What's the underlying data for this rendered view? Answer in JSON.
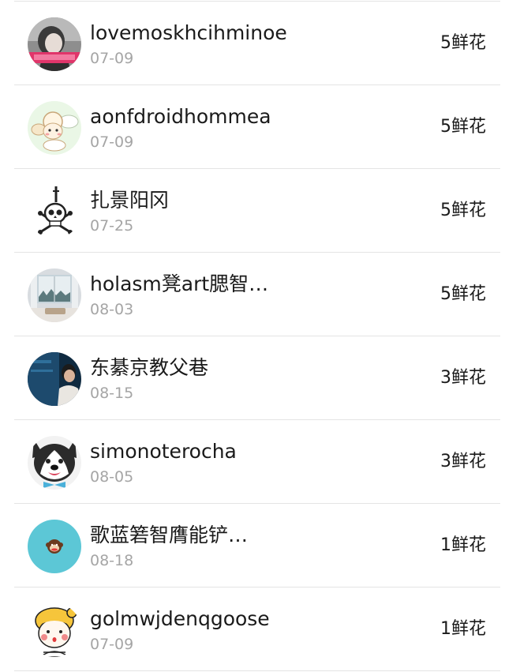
{
  "flower_unit": "鲜花",
  "entries": [
    {
      "name": "lovemoskhcihminoe",
      "date": "07-09",
      "count": "5",
      "avatar_icon": "woman-portrait-avatar-icon"
    },
    {
      "name": "aonfdroidhommea",
      "date": "07-09",
      "count": "5",
      "avatar_icon": "cartoon-sheep-avatar-icon"
    },
    {
      "name": "扎景阳冈",
      "date": "07-25",
      "count": "5",
      "avatar_icon": "skull-crossbones-avatar-icon"
    },
    {
      "name": "holasm凳art腮智…",
      "date": "08-03",
      "count": "5",
      "avatar_icon": "room-window-avatar-icon"
    },
    {
      "name": "东綦京教父巷",
      "date": "08-15",
      "count": "3",
      "avatar_icon": "man-blue-background-avatar-icon"
    },
    {
      "name": "simonoterocha",
      "date": "08-05",
      "count": "3",
      "avatar_icon": "husky-dog-avatar-icon"
    },
    {
      "name": "歌蓝箬智膺能铲…",
      "date": "08-18",
      "count": "1",
      "avatar_icon": "monkey-logo-avatar-icon"
    },
    {
      "name": "golmwjdenqgoose",
      "date": "07-09",
      "count": "1",
      "avatar_icon": "cartoon-girl-avatar-icon"
    }
  ]
}
